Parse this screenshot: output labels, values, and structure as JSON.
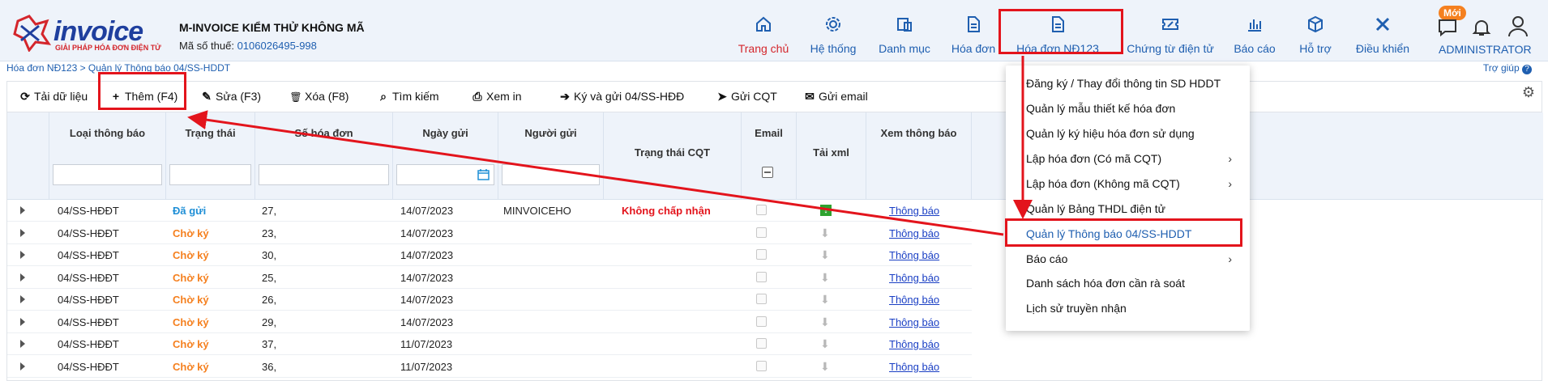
{
  "brand": {
    "name": "invoice",
    "tagline": "GIẢI PHÁP HÓA ĐƠN ĐIỆN TỬ"
  },
  "company": {
    "name": "M-INVOICE KIỂM THỬ KHÔNG MÃ",
    "tax_label": "Mã số thuế:",
    "tax_code": "0106026495-998"
  },
  "breadcrumb": "Hóa đơn NĐ123 > Quản lý Thông báo 04/SS-HDDT",
  "help": "Trợ giúp",
  "nav": [
    {
      "label": "Trang chủ",
      "icon": "home-icon"
    },
    {
      "label": "Hệ thống",
      "icon": "gear-icon"
    },
    {
      "label": "Danh mục",
      "icon": "folder-icon"
    },
    {
      "label": "Hóa đơn",
      "icon": "document-icon"
    },
    {
      "label": "Hóa đơn NĐ123",
      "icon": "document-icon"
    },
    {
      "label": "Chứng từ điện tử",
      "icon": "ticket-icon"
    },
    {
      "label": "Báo cáo",
      "icon": "bar-chart-icon"
    },
    {
      "label": "Hỗ trợ",
      "icon": "cube-icon"
    },
    {
      "label": "Điều khiển",
      "icon": "tools-icon"
    }
  ],
  "user": {
    "name": "ADMINISTRATOR",
    "badge": "Mới"
  },
  "toolbar": [
    {
      "label": "Tải dữ liệu",
      "icon": "refresh-icon",
      "glyph": "⟳"
    },
    {
      "label": "Thêm (F4)",
      "icon": "plus-icon",
      "glyph": "+"
    },
    {
      "label": "Sửa (F3)",
      "icon": "edit-icon",
      "glyph": "✎"
    },
    {
      "label": "Xóa (F8)",
      "icon": "trash-icon",
      "glyph": "🗑"
    },
    {
      "label": "Tìm kiếm",
      "icon": "search-icon",
      "glyph": "⌕"
    },
    {
      "label": "Xem in",
      "icon": "print-icon",
      "glyph": "⎙"
    },
    {
      "label": "Ký và gửi 04/SS-HĐĐ",
      "icon": "sign-in-icon",
      "glyph": "➔"
    },
    {
      "label": "Gửi CQT",
      "icon": "send-icon",
      "glyph": "➤"
    },
    {
      "label": "Gửi email",
      "icon": "email-icon",
      "glyph": "✉"
    }
  ],
  "columns": [
    "Loại thông báo",
    "Trạng thái",
    "Số hóa đơn",
    "Ngày gửi",
    "Người gửi",
    "Trạng thái CQT",
    "Email",
    "Tải xml",
    "Xem thông báo"
  ],
  "rows": [
    {
      "type": "04/SS-HĐĐT",
      "status": "Đã gửi",
      "number": "27,",
      "date": "14/07/2023",
      "sender": "MINVOICEHO",
      "cqt": "Không chấp nhận",
      "xml": "green",
      "view": "Thông báo"
    },
    {
      "type": "04/SS-HĐĐT",
      "status": "Chờ ký",
      "number": "23,",
      "date": "14/07/2023",
      "sender": "",
      "cqt": "",
      "xml": "gray",
      "view": "Thông báo"
    },
    {
      "type": "04/SS-HĐĐT",
      "status": "Chờ ký",
      "number": "30,",
      "date": "14/07/2023",
      "sender": "",
      "cqt": "",
      "xml": "gray",
      "view": "Thông báo"
    },
    {
      "type": "04/SS-HĐĐT",
      "status": "Chờ ký",
      "number": "25,",
      "date": "14/07/2023",
      "sender": "",
      "cqt": "",
      "xml": "gray",
      "view": "Thông báo"
    },
    {
      "type": "04/SS-HĐĐT",
      "status": "Chờ ký",
      "number": "26,",
      "date": "14/07/2023",
      "sender": "",
      "cqt": "",
      "xml": "gray",
      "view": "Thông báo"
    },
    {
      "type": "04/SS-HĐĐT",
      "status": "Chờ ký",
      "number": "29,",
      "date": "14/07/2023",
      "sender": "",
      "cqt": "",
      "xml": "gray",
      "view": "Thông báo"
    },
    {
      "type": "04/SS-HĐĐT",
      "status": "Chờ ký",
      "number": "37,",
      "date": "11/07/2023",
      "sender": "",
      "cqt": "",
      "xml": "gray",
      "view": "Thông báo"
    },
    {
      "type": "04/SS-HĐĐT",
      "status": "Chờ ký",
      "number": "36,",
      "date": "11/07/2023",
      "sender": "",
      "cqt": "",
      "xml": "gray",
      "view": "Thông báo"
    }
  ],
  "dropdown": [
    {
      "label": "Đăng ký / Thay đổi thông tin SD HDDT",
      "submenu": false
    },
    {
      "label": "Quản lý mẫu thiết kế hóa đơn",
      "submenu": false
    },
    {
      "label": "Quản lý ký hiệu hóa đơn sử dụng",
      "submenu": false
    },
    {
      "label": "Lập hóa đơn (Có mã CQT)",
      "submenu": true
    },
    {
      "label": "Lập hóa đơn (Không mã CQT)",
      "submenu": true
    },
    {
      "label": "Quản lý Bảng THDL điện tử",
      "submenu": false
    },
    {
      "label": "Quản lý Thông báo 04/SS-HDDT",
      "submenu": false,
      "highlighted": true
    },
    {
      "label": "Báo cáo",
      "submenu": true
    },
    {
      "label": "Danh sách hóa đơn cần rà soát",
      "submenu": false
    },
    {
      "label": "Lịch sử truyền nhận",
      "submenu": false
    }
  ],
  "colors": {
    "primary": "#1f5fb0",
    "active": "#d4262c",
    "annotation": "#e3141c",
    "waiting": "#f5801f",
    "sent": "#1f8fd6"
  }
}
